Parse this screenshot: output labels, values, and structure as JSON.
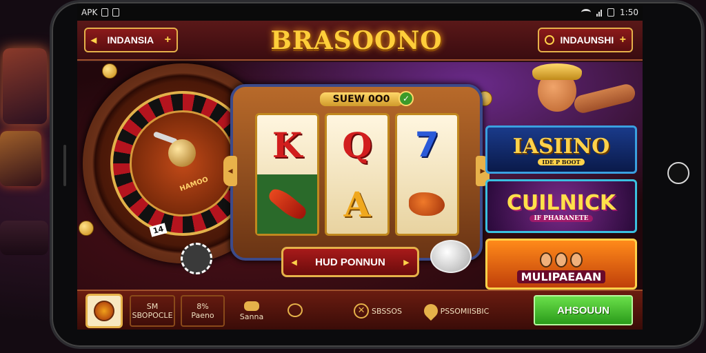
{
  "status_bar": {
    "left_label": "APK",
    "time": "1:50"
  },
  "header": {
    "left_button": "INDANSIA",
    "brand_title": "BRASOONO",
    "right_button": "INDAUNSHI"
  },
  "slot_machine": {
    "title": "SUEW 0O0",
    "reels": [
      {
        "top": "K",
        "bottom_icon": "chili-pepper-icon"
      },
      {
        "top": "Q",
        "bottom": "A"
      },
      {
        "top": "7",
        "bottom_icon": "fruit-icon"
      }
    ],
    "play_button": "HUD PONNUN"
  },
  "roulette": {
    "label": "HAMOO",
    "number": "14"
  },
  "promos": [
    {
      "title": "IASIINO",
      "subtitle": "IDE P BOOT"
    },
    {
      "title": "CUILNICK",
      "subtitle": "IF PHARANETE"
    },
    {
      "title": "MULIPAEAAN"
    }
  ],
  "bottom_bar": {
    "items": [
      {
        "top": "SM",
        "bottom": "SBOPOCLE"
      },
      {
        "top": "8%",
        "bottom": "Paeno"
      },
      {
        "bottom": "Sanna",
        "icon": "hand-icon"
      },
      {
        "icon": "moneybag-icon"
      },
      {
        "label": "SBSSOS",
        "icon": "close-circle-icon"
      },
      {
        "label": "PSSOMIISBIC",
        "icon": "location-pin-icon"
      }
    ],
    "cta_label": "AHSOUUN"
  },
  "colors": {
    "accent_gold": "#e6b24a",
    "brand_red": "#8b1a1a",
    "cta_green": "#2a9a1a"
  }
}
